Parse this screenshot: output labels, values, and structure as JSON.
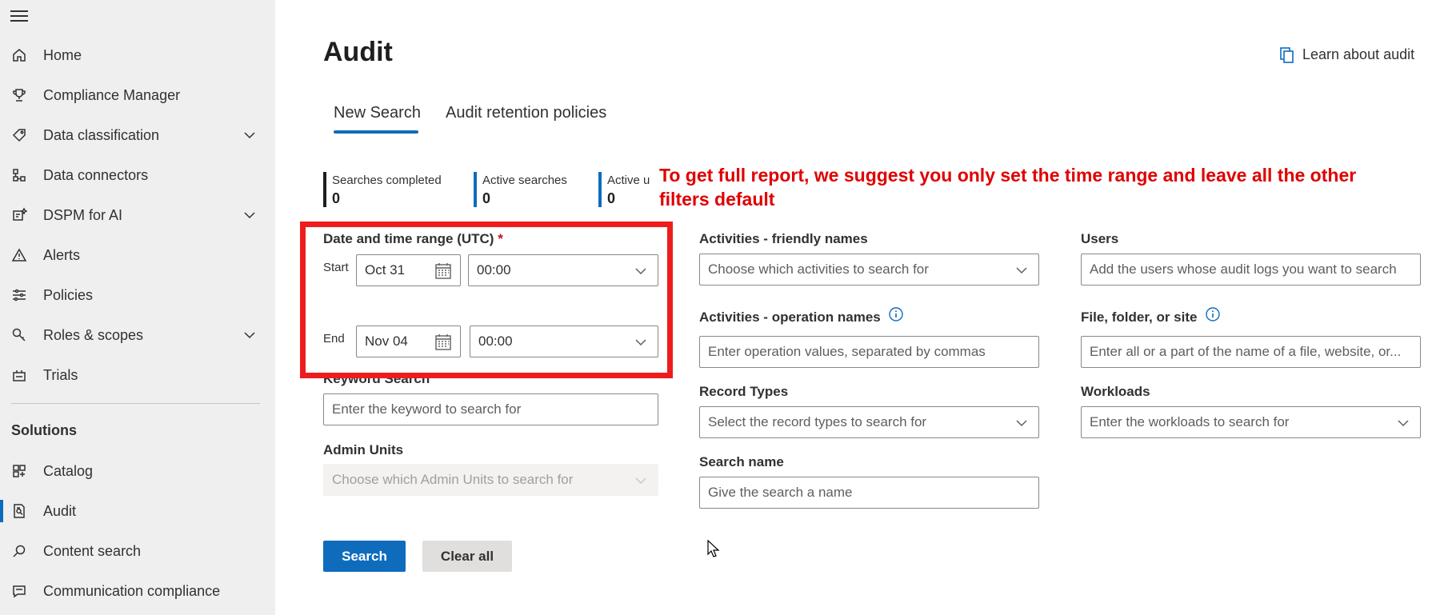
{
  "sidebar": {
    "items": [
      {
        "label": "Home",
        "icon": "home-icon"
      },
      {
        "label": "Compliance Manager",
        "icon": "trophy-icon"
      },
      {
        "label": "Data classification",
        "icon": "tag-icon"
      },
      {
        "label": "Data connectors",
        "icon": "connector-icon"
      },
      {
        "label": "DSPM for AI",
        "icon": "ai-icon"
      },
      {
        "label": "Alerts",
        "icon": "alert-icon"
      },
      {
        "label": "Policies",
        "icon": "sliders-icon"
      },
      {
        "label": "Roles & scopes",
        "icon": "key-search-icon"
      },
      {
        "label": "Trials",
        "icon": "trials-icon"
      }
    ],
    "solutions_heading": "Solutions",
    "solutions": [
      {
        "label": "Catalog",
        "icon": "catalog-icon"
      },
      {
        "label": "Audit",
        "icon": "audit-icon"
      },
      {
        "label": "Content search",
        "icon": "search-icon"
      },
      {
        "label": "Communication compliance",
        "icon": "chat-icon"
      }
    ]
  },
  "header": {
    "title": "Audit",
    "learn_link": "Learn about audit"
  },
  "tabs": [
    {
      "label": "New Search",
      "active": true
    },
    {
      "label": "Audit retention policies",
      "active": false
    }
  ],
  "stats": [
    {
      "label": "Searches completed",
      "value": "0",
      "color": "#201f1e"
    },
    {
      "label": "Active searches",
      "value": "0",
      "color": "#0f6cbd"
    },
    {
      "label": "Active u",
      "value": "0",
      "color": "#0f6cbd"
    }
  ],
  "annotation": "To get full report, we suggest you only set the time range and leave all the other filters default",
  "form": {
    "date_range": {
      "label": "Date and time range (UTC)",
      "required_mark": "*",
      "start_label": "Start",
      "start_date": "Oct 31",
      "start_time": "00:00",
      "end_label": "End",
      "end_date": "Nov 04",
      "end_time": "00:00"
    },
    "keyword": {
      "label": "Keyword Search",
      "placeholder": "Enter the keyword to search for"
    },
    "admin_units": {
      "label": "Admin Units",
      "placeholder": "Choose which Admin Units to search for"
    },
    "activities_friendly": {
      "label": "Activities - friendly names",
      "placeholder": "Choose which activities to search for"
    },
    "activities_operation": {
      "label": "Activities - operation names",
      "placeholder": "Enter operation values, separated by commas"
    },
    "record_types": {
      "label": "Record Types",
      "placeholder": "Select the record types to search for"
    },
    "search_name": {
      "label": "Search name",
      "placeholder": "Give the search a name"
    },
    "users": {
      "label": "Users",
      "placeholder": "Add the users whose audit logs you want to search"
    },
    "file_folder_site": {
      "label": "File, folder, or site",
      "placeholder": "Enter all or a part of the name of a file, website, or..."
    },
    "workloads": {
      "label": "Workloads",
      "placeholder": "Enter the workloads to search for"
    }
  },
  "buttons": {
    "search": "Search",
    "clear_all": "Clear all"
  },
  "colors": {
    "accent": "#0f6cbd",
    "annotation_red": "#e00000",
    "highlight_box": "#ee1c1c",
    "sidebar_bg": "#efefef"
  }
}
